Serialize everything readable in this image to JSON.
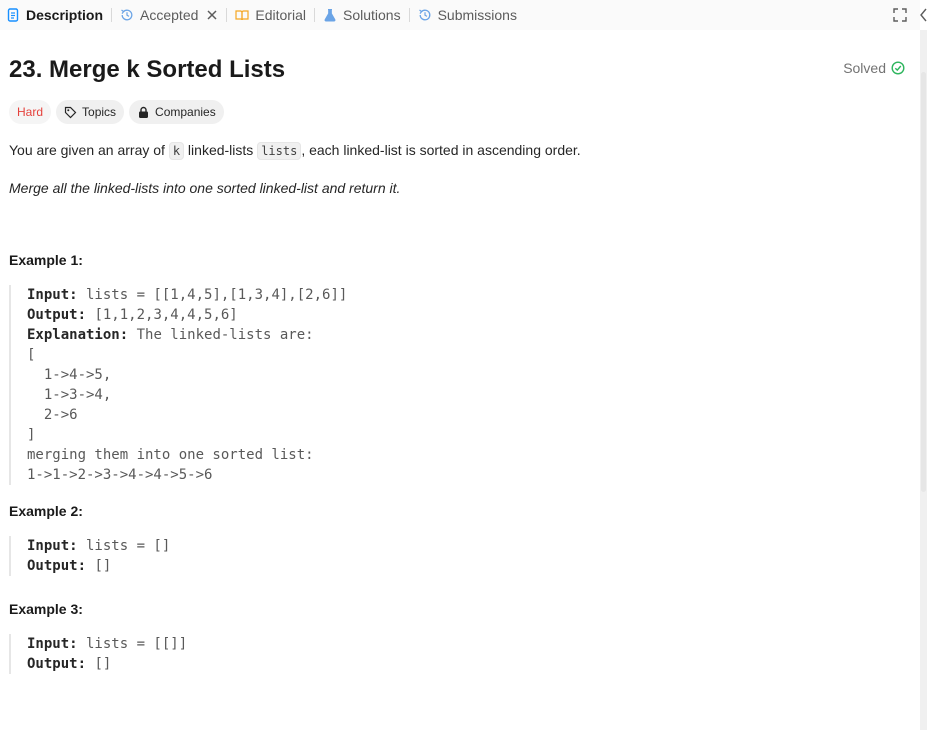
{
  "tabs": {
    "description": "Description",
    "accepted": "Accepted",
    "editorial": "Editorial",
    "solutions": "Solutions",
    "submissions": "Submissions"
  },
  "problem": {
    "title": "23. Merge k Sorted Lists",
    "status": "Solved",
    "tags": {
      "difficulty": "Hard",
      "topics": "Topics",
      "companies": "Companies"
    },
    "desc": {
      "p1_a": "You are given an array of ",
      "p1_code1": "k",
      "p1_b": " linked-lists ",
      "p1_code2": "lists",
      "p1_c": ", each linked-list is sorted in ascending order.",
      "p2": "Merge all the linked-lists into one sorted linked-list and return it."
    },
    "examples": [
      {
        "title": "Example 1:",
        "input_label": "Input:",
        "input": " lists = [[1,4,5],[1,3,4],[2,6]]",
        "output_label": "Output:",
        "output": " [1,1,2,3,4,4,5,6]",
        "explanation_label": "Explanation:",
        "explanation": " The linked-lists are:\n[\n  1->4->5,\n  1->3->4,\n  2->6\n]\nmerging them into one sorted list:\n1->1->2->3->4->4->5->6"
      },
      {
        "title": "Example 2:",
        "input_label": "Input:",
        "input": " lists = []",
        "output_label": "Output:",
        "output": " []"
      },
      {
        "title": "Example 3:",
        "input_label": "Input:",
        "input": " lists = [[]]",
        "output_label": "Output:",
        "output": " []"
      }
    ]
  },
  "colors": {
    "accent_blue": "#1890ff",
    "hard_red": "#e5423d",
    "solved_green": "#2db55d",
    "editorial_orange": "#f5a623"
  },
  "icons": {
    "description": "document-icon",
    "accepted": "history-icon",
    "editorial": "book-icon",
    "solutions": "flask-icon",
    "submissions": "history-icon",
    "fullscreen": "expand-icon",
    "collapse": "chevron-left-icon",
    "solved": "check-circle-icon",
    "topics": "tag-icon",
    "companies": "lock-icon"
  }
}
